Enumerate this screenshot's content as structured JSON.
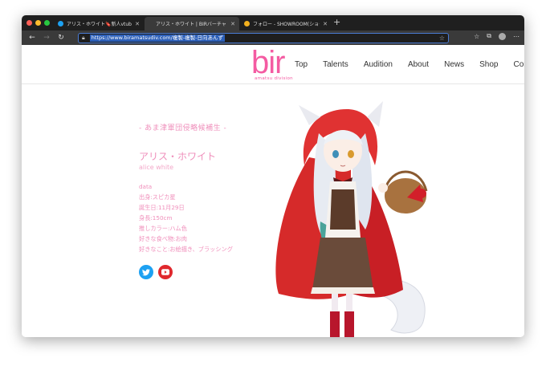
{
  "browser": {
    "tabs": [
      {
        "label": "アリス・ホワイト🔖新人vtuber",
        "favicon_color": "#1da1f2",
        "active": false
      },
      {
        "label": "アリス・ホワイト | BIRバーチャ",
        "favicon_color": "#888888",
        "active": true
      },
      {
        "label": "フォロー - SHOWROOM(ショー",
        "favicon_color": "#f2b01e",
        "active": false
      }
    ],
    "url": "https://www.biramatsudiv.com/複製-複製-日向あんず"
  },
  "site": {
    "logo_text": "bir",
    "logo_sub": "amatsu division",
    "brand_color": "#f45ba2",
    "nav": [
      "Top",
      "Talents",
      "Audition",
      "About",
      "News",
      "Shop",
      "Contact"
    ]
  },
  "profile": {
    "tagline": "- あま津軍団侵略候補生 -",
    "name_jp": "アリス・ホワイト",
    "name_en": "alice white",
    "data_heading": "data",
    "data_lines": [
      "出身:スピカ星",
      "誕生日:11月29日",
      "身長:150cm",
      "推しカラー:ハム色",
      "好きな食べ物:お肉",
      "好きなこと:お絵描き、ブラッシング"
    ],
    "social": [
      {
        "icon": "twitter-icon",
        "color": "#1da1f2"
      },
      {
        "icon": "youtube-icon",
        "color": "#e0282d"
      }
    ]
  }
}
